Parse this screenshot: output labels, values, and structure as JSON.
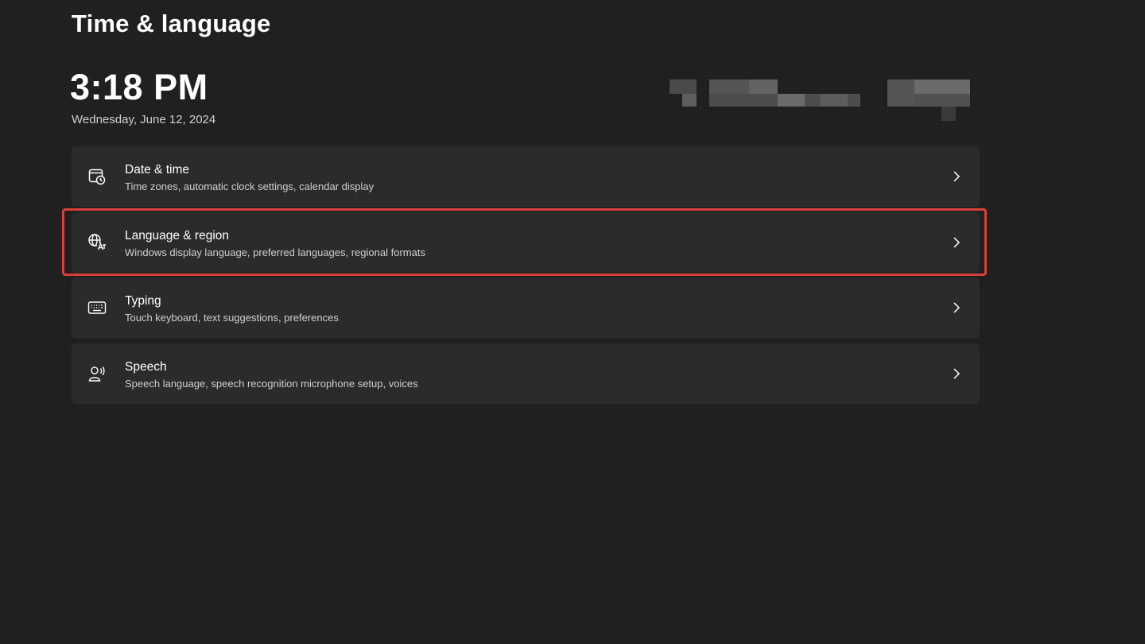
{
  "page": {
    "title": "Time & language",
    "clock_time": "3:18 PM",
    "clock_date": "Wednesday, June 12, 2024"
  },
  "cards": [
    {
      "title": "Date & time",
      "subtitle": "Time zones, automatic clock settings, calendar display",
      "icon": "calendar-clock-icon"
    },
    {
      "title": "Language & region",
      "subtitle": "Windows display language, preferred languages, regional formats",
      "icon": "language-globe-icon"
    },
    {
      "title": "Typing",
      "subtitle": "Touch keyboard, text suggestions, preferences",
      "icon": "keyboard-icon"
    },
    {
      "title": "Speech",
      "subtitle": "Speech language, speech recognition microphone setup, voices",
      "icon": "speech-person-icon"
    }
  ],
  "highlight": {
    "color": "#d9403a",
    "target": "Language & region"
  },
  "colors": {
    "background": "#202020",
    "card": "#2b2b2b",
    "text": "#ffffff",
    "subtext": "#cfcfcf"
  }
}
